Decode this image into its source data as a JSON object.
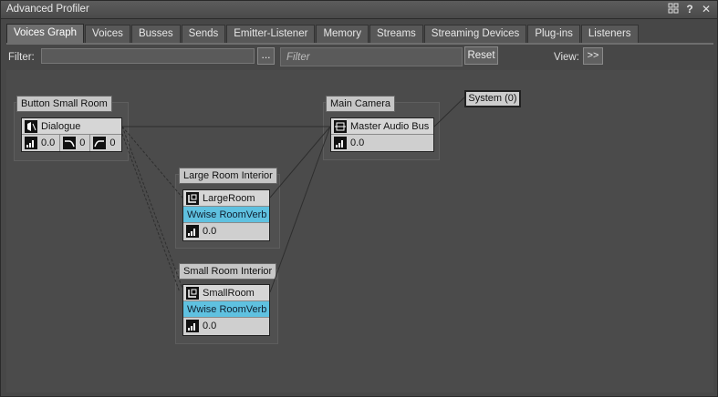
{
  "window": {
    "title": "Advanced Profiler"
  },
  "titlebar_icons": [
    "layout-icon",
    "help-icon",
    "close-icon"
  ],
  "tabs": [
    {
      "label": "Voices Graph",
      "active": true
    },
    {
      "label": "Voices"
    },
    {
      "label": "Busses"
    },
    {
      "label": "Sends"
    },
    {
      "label": "Emitter-Listener"
    },
    {
      "label": "Memory"
    },
    {
      "label": "Streams"
    },
    {
      "label": "Streaming Devices"
    },
    {
      "label": "Plug-ins"
    },
    {
      "label": "Listeners"
    }
  ],
  "filterbar": {
    "filter_label": "Filter:",
    "filter_value": "",
    "dots_label": "...",
    "search_placeholder": "Filter",
    "reset_label": "Reset",
    "view_label": "View:",
    "view_btn_label": ">>"
  },
  "graph": {
    "groups": {
      "button_small_room": {
        "title": "Button Small Room"
      },
      "main_camera": {
        "title": "Main Camera"
      },
      "large_room_interior": {
        "title": "Large Room Interior"
      },
      "small_room_interior": {
        "title": "Small Room Interior"
      }
    },
    "nodes": {
      "dialogue": {
        "name": "Dialogue",
        "volume": "0.0",
        "lpf": "0",
        "hpf": "0"
      },
      "master_audio_bus": {
        "name": "Master Audio Bus",
        "volume": "0.0"
      },
      "large_room": {
        "name": "LargeRoom",
        "effect": "Wwise RoomVerb",
        "volume": "0.0"
      },
      "small_room": {
        "name": "SmallRoom",
        "effect": "Wwise RoomVerb",
        "volume": "0.0"
      }
    },
    "system": {
      "label": "System (0)"
    }
  },
  "colors": {
    "effect_row": "#5fc1e0",
    "panel_bg": "#4b4b4b"
  }
}
